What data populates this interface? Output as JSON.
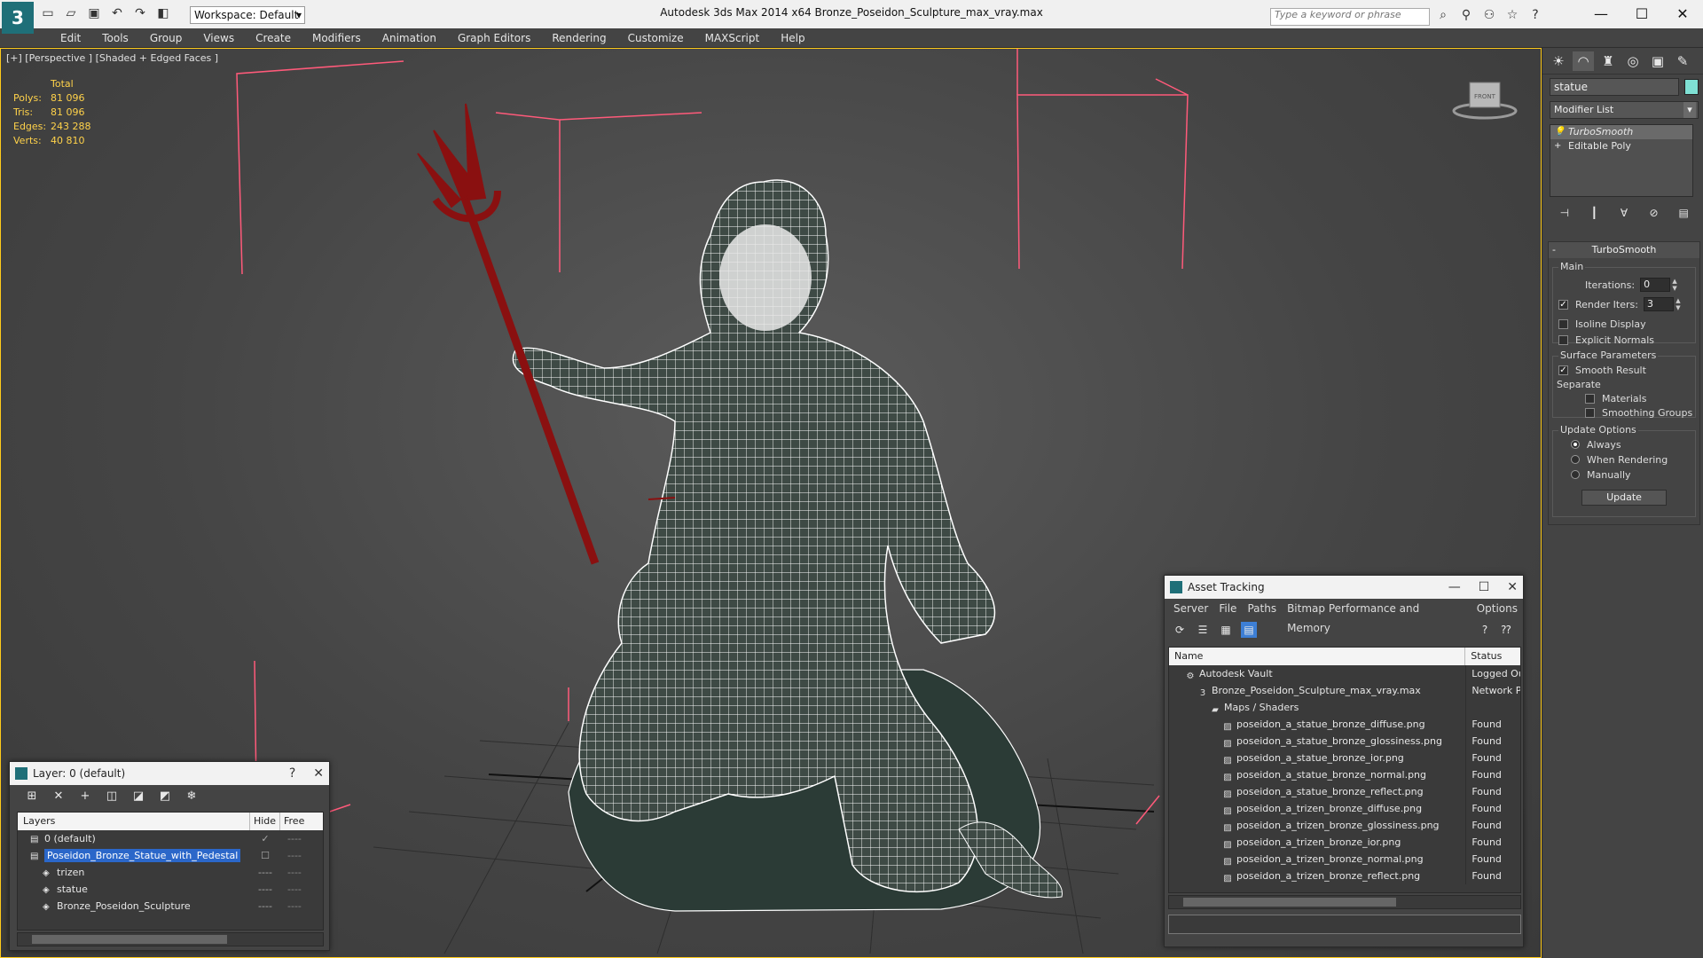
{
  "titlebar": {
    "app_logo": "3",
    "workspace_label": "Workspace: Default",
    "title": "Autodesk 3ds Max  2014 x64      Bronze_Poseidon_Sculpture_max_vray.max",
    "search_placeholder": "Type a keyword or phrase",
    "qat_icons": [
      "new-icon",
      "open-icon",
      "save-icon",
      "undo-icon",
      "redo-icon",
      "project-icon"
    ],
    "search_tool_icons": [
      "binoculars-icon",
      "search-icon",
      "signin-icon",
      "star-icon",
      "help-icon"
    ],
    "window_controls": [
      "—",
      "☐",
      "✕"
    ]
  },
  "menu": {
    "items": [
      "Edit",
      "Tools",
      "Group",
      "Views",
      "Create",
      "Modifiers",
      "Animation",
      "Graph Editors",
      "Rendering",
      "Customize",
      "MAXScript",
      "Help"
    ]
  },
  "viewport": {
    "label": "[+] [Perspective ] [Shaded + Edged Faces ]",
    "stats": {
      "header": "Total",
      "rows": [
        {
          "key": "Polys:",
          "value": "81 096"
        },
        {
          "key": "Tris:",
          "value": "81 096"
        },
        {
          "key": "Edges:",
          "value": "243 288"
        },
        {
          "key": "Verts:",
          "value": "40 810"
        }
      ]
    },
    "viewcube_label": "FRONT",
    "wire_color": "#ffffff",
    "trident_color": "#8a1010",
    "helper_color": "#ff5a7a"
  },
  "command_panel": {
    "tabs": [
      "☀",
      "◠",
      "♜",
      "◎",
      "▣",
      "✎"
    ],
    "object_name": "statue",
    "object_color": "#7fe0d4",
    "modifier_list_label": "Modifier List",
    "stack": [
      "TurboSmooth",
      "Editable Poly"
    ],
    "turbosmooth": {
      "header": "TurboSmooth",
      "main_label": "Main",
      "iterations_label": "Iterations:",
      "iterations_value": "0",
      "render_iters_label": "Render Iters:",
      "render_iters_value": "3",
      "isoline_label": "Isoline Display",
      "explicit_normals_label": "Explicit Normals",
      "surface_label": "Surface Parameters",
      "smooth_result_label": "Smooth Result",
      "separate_label": "Separate",
      "materials_label": "Materials",
      "smoothing_groups_label": "Smoothing Groups",
      "update_options_label": "Update Options",
      "always_label": "Always",
      "when_rendering_label": "When Rendering",
      "manually_label": "Manually",
      "update_button": "Update"
    }
  },
  "asset_tracking": {
    "title": "Asset Tracking",
    "menu": [
      "Server",
      "File",
      "Paths",
      "Bitmap Performance and Memory",
      "Options"
    ],
    "columns": [
      "Name",
      "Status"
    ],
    "rows": [
      {
        "indent": 1,
        "icon": "vault-icon",
        "name": "Autodesk Vault",
        "status": "Logged Out"
      },
      {
        "indent": 2,
        "icon": "max-file-icon",
        "name": "Bronze_Poseidon_Sculpture_max_vray.max",
        "status": "Network Path"
      },
      {
        "indent": 3,
        "icon": "maps-folder-icon",
        "name": "Maps / Shaders",
        "status": ""
      },
      {
        "indent": 4,
        "icon": "image-file-icon",
        "name": "poseidon_a_statue_bronze_diffuse.png",
        "status": "Found"
      },
      {
        "indent": 4,
        "icon": "image-file-icon",
        "name": "poseidon_a_statue_bronze_glossiness.png",
        "status": "Found"
      },
      {
        "indent": 4,
        "icon": "image-file-icon",
        "name": "poseidon_a_statue_bronze_ior.png",
        "status": "Found"
      },
      {
        "indent": 4,
        "icon": "image-file-icon",
        "name": "poseidon_a_statue_bronze_normal.png",
        "status": "Found"
      },
      {
        "indent": 4,
        "icon": "image-file-icon",
        "name": "poseidon_a_statue_bronze_reflect.png",
        "status": "Found"
      },
      {
        "indent": 4,
        "icon": "image-file-icon",
        "name": "poseidon_a_trizen_bronze_diffuse.png",
        "status": "Found"
      },
      {
        "indent": 4,
        "icon": "image-file-icon",
        "name": "poseidon_a_trizen_bronze_glossiness.png",
        "status": "Found"
      },
      {
        "indent": 4,
        "icon": "image-file-icon",
        "name": "poseidon_a_trizen_bronze_ior.png",
        "status": "Found"
      },
      {
        "indent": 4,
        "icon": "image-file-icon",
        "name": "poseidon_a_trizen_bronze_normal.png",
        "status": "Found"
      },
      {
        "indent": 4,
        "icon": "image-file-icon",
        "name": "poseidon_a_trizen_bronze_reflect.png",
        "status": "Found"
      }
    ]
  },
  "layer_window": {
    "title": "Layer: 0 (default)",
    "help": "?",
    "close": "✕",
    "columns": [
      "Layers",
      "Hide",
      "Free"
    ],
    "rows": [
      {
        "indent": 1,
        "name": "0 (default)",
        "hide": "✓",
        "free": "----",
        "selected": false
      },
      {
        "indent": 1,
        "name": "Poseidon_Bronze_Statue_with_Pedestal",
        "hide": "☐",
        "free": "----",
        "selected": true
      },
      {
        "indent": 2,
        "name": "trizen",
        "hide": "----",
        "free": "----",
        "selected": false
      },
      {
        "indent": 2,
        "name": "statue",
        "hide": "----",
        "free": "----",
        "selected": false
      },
      {
        "indent": 2,
        "name": "Bronze_Poseidon_Sculpture",
        "hide": "----",
        "free": "----",
        "selected": false
      }
    ]
  }
}
